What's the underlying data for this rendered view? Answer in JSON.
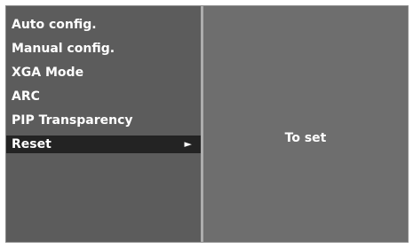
{
  "menu": {
    "items": [
      {
        "label": "Auto config."
      },
      {
        "label": "Manual config."
      },
      {
        "label": "XGA Mode"
      },
      {
        "label": "ARC"
      },
      {
        "label": "PIP Transparency"
      },
      {
        "label": "Reset",
        "selected": true,
        "submenu_icon": "right-triangle-icon"
      }
    ]
  },
  "detail": {
    "text": "To set"
  },
  "colors": {
    "menu_bg": "#5c5c5c",
    "detail_bg": "#6e6e6e",
    "selected_bg": "#232323",
    "text": "#ffffff"
  }
}
